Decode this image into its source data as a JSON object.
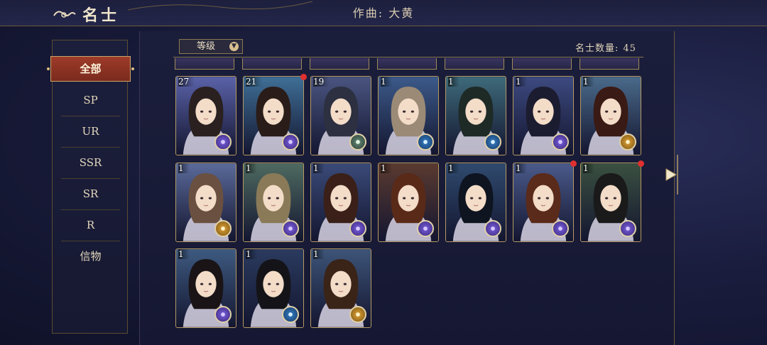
{
  "header": {
    "title": "名士",
    "song": "作曲: 大黄"
  },
  "sidebar": {
    "items": [
      {
        "label": "全部",
        "active": true
      },
      {
        "label": "SP",
        "active": false
      },
      {
        "label": "UR",
        "active": false
      },
      {
        "label": "SSR",
        "active": false
      },
      {
        "label": "SR",
        "active": false
      },
      {
        "label": "R",
        "active": false
      },
      {
        "label": "信物",
        "active": false
      }
    ]
  },
  "toolbar": {
    "sort_label": "等级",
    "count_label": "名士数量:",
    "count_value": "45"
  },
  "cards": [
    {
      "level": "27",
      "faction": "purple",
      "new": false,
      "bg": "#5a62a8",
      "hair": "#2a2020"
    },
    {
      "level": "21",
      "faction": "purple",
      "new": true,
      "bg": "#3f6f96",
      "hair": "#2a1c18"
    },
    {
      "level": "19",
      "faction": "green",
      "new": false,
      "bg": "#4a5580",
      "hair": "#2c3040"
    },
    {
      "level": "1",
      "faction": "blue",
      "new": false,
      "bg": "#3c5a8a",
      "hair": "#9a8a76"
    },
    {
      "level": "1",
      "faction": "blue",
      "new": false,
      "bg": "#3e6a7a",
      "hair": "#1e2a26"
    },
    {
      "level": "1",
      "faction": "purple",
      "new": false,
      "bg": "#3d4a80",
      "hair": "#1c1c30"
    },
    {
      "level": "1",
      "faction": "gold",
      "new": false,
      "bg": "#4a6a8a",
      "hair": "#3a1a14"
    },
    {
      "level": "1",
      "faction": "gold",
      "new": false,
      "bg": "#5a6a9a",
      "hair": "#6a5040"
    },
    {
      "level": "1",
      "faction": "purple",
      "new": false,
      "bg": "#4e6a60",
      "hair": "#8a7a58"
    },
    {
      "level": "1",
      "faction": "purple",
      "new": false,
      "bg": "#3a4a78",
      "hair": "#3a2018"
    },
    {
      "level": "1",
      "faction": "purple",
      "new": false,
      "bg": "#5a3a30",
      "hair": "#5a2a18"
    },
    {
      "level": "1",
      "faction": "purple",
      "new": false,
      "bg": "#2f4a6e",
      "hair": "#0e1420"
    },
    {
      "level": "1",
      "faction": "purple",
      "new": true,
      "bg": "#4a5a8a",
      "hair": "#5a2a1a"
    },
    {
      "level": "1",
      "faction": "purple",
      "new": true,
      "bg": "#3a5040",
      "hair": "#1a1a1a"
    },
    {
      "level": "1",
      "faction": "purple",
      "new": false,
      "bg": "#3e5a80",
      "hair": "#1a1416"
    },
    {
      "level": "1",
      "faction": "blue",
      "new": false,
      "bg": "#2a3a5e",
      "hair": "#141418"
    },
    {
      "level": "1",
      "faction": "gold",
      "new": false,
      "bg": "#3d5478",
      "hair": "#3a2418"
    }
  ],
  "icons": {
    "title": "swirl-icon",
    "sort": "chevron-down-icon",
    "next": "arrow-right-icon"
  },
  "colors": {
    "accent": "#9e3b2a",
    "gold": "#b59a62",
    "badge": "#e03030"
  }
}
